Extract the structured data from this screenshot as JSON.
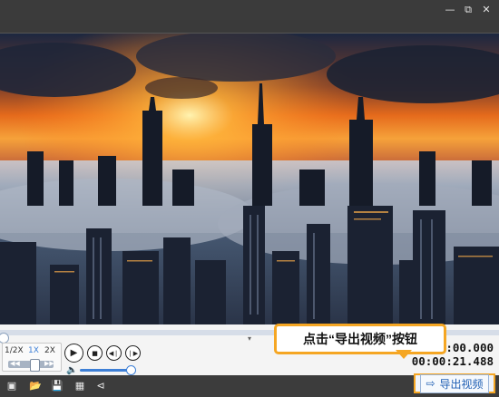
{
  "window": {
    "minimize_icon": "minimize-icon",
    "restore_icon": "restore-icon"
  },
  "player": {
    "speed_options": [
      "1/2X",
      "1X",
      "2X"
    ],
    "active_speed": "1X",
    "accent": "#3d7fd6",
    "time_current": "00:00:00.000",
    "time_total": "00:00:21.488",
    "seek_progress": 0,
    "volume_level": 1.0
  },
  "tooltip": {
    "text": "点击“导出视频”按钮",
    "border_color": "#f5a623"
  },
  "toolbar": {
    "icons": [
      "new-project-icon",
      "open-folder-icon",
      "save-icon",
      "save-as-icon",
      "share-icon"
    ],
    "export_label": "导出视频"
  }
}
